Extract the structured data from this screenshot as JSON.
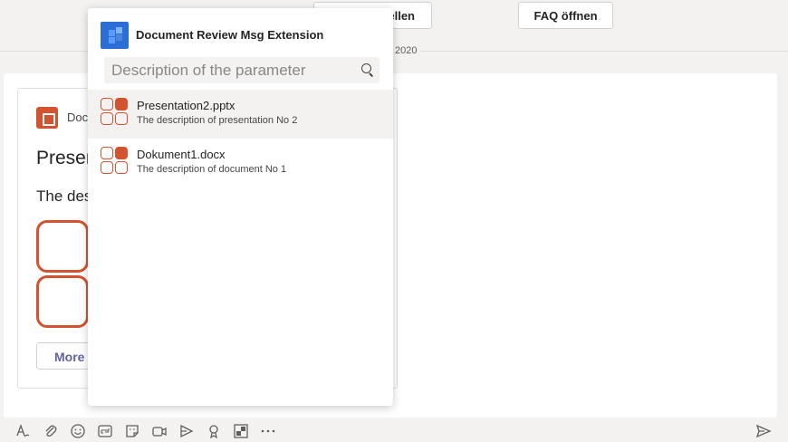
{
  "top_buttons": {
    "create_label": "ellen",
    "faq_label": "FAQ öffnen"
  },
  "date_label": "2020",
  "card": {
    "app_name": "Doc",
    "title": "Presen",
    "description": "The des",
    "more_button": "More o"
  },
  "popup": {
    "title": "Document Review Msg Extension",
    "search_placeholder": "Description of the parameter",
    "results": [
      {
        "name": "Presentation2.pptx",
        "description": "The description of presentation No 2"
      },
      {
        "name": "Dokument1.docx",
        "description": "The description of document No 1"
      }
    ]
  },
  "toolbar": {
    "icons": [
      "format-icon",
      "attach-icon",
      "emoji-icon",
      "gif-icon",
      "sticker-icon",
      "meet-icon",
      "stream-icon",
      "praise-icon",
      "doc-review-extension-icon",
      "more-icon"
    ],
    "send_icon": "send-icon"
  },
  "colors": {
    "accent": "#6264a7",
    "ppt_orange": "#d35230",
    "extension_blue": "#2b6fd6"
  }
}
